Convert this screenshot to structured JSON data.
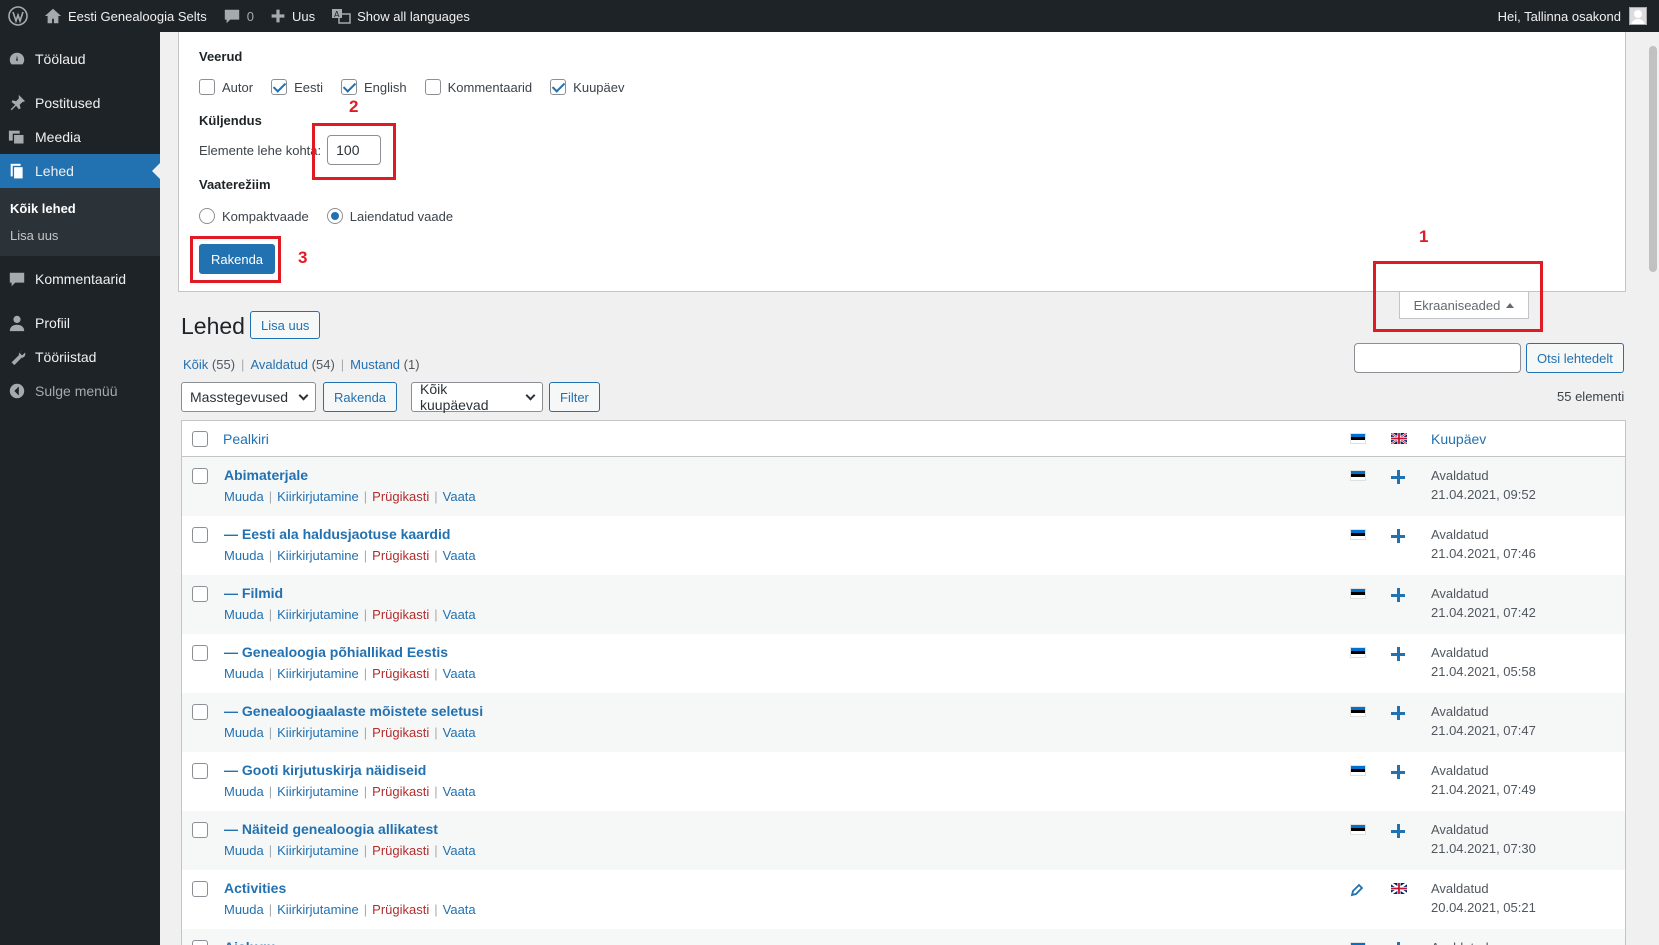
{
  "adminbar": {
    "site_name": "Eesti Genealoogia Selts",
    "comments_count": "0",
    "new_label": "Uus",
    "languages_label": "Show all languages",
    "greeting": "Hei, Tallinna osakond"
  },
  "sidebar": {
    "items": [
      {
        "label": "Töölaud",
        "icon": "dashboard-icon"
      },
      {
        "label": "Postitused",
        "icon": "pin-icon"
      },
      {
        "label": "Meedia",
        "icon": "media-icon"
      },
      {
        "label": "Lehed",
        "icon": "pages-icon"
      },
      {
        "label": "Kommentaarid",
        "icon": "comments-icon"
      },
      {
        "label": "Profiil",
        "icon": "user-icon"
      },
      {
        "label": "Tööriistad",
        "icon": "wrench-icon"
      },
      {
        "label": "Sulge menüü",
        "icon": "collapse-icon"
      }
    ],
    "submenu": [
      "Kõik lehed",
      "Lisa uus"
    ]
  },
  "screen_options": {
    "columns_legend": "Veerud",
    "columns": [
      {
        "label": "Autor",
        "checked": false
      },
      {
        "label": "Eesti",
        "checked": true
      },
      {
        "label": "English",
        "checked": true
      },
      {
        "label": "Kommentaarid",
        "checked": false
      },
      {
        "label": "Kuupäev",
        "checked": true
      }
    ],
    "pagination_legend": "Küljendus",
    "per_page_label": "Elemente lehe kohta:",
    "per_page_value": "100",
    "view_mode_legend": "Vaaterežiim",
    "view_modes": [
      {
        "label": "Kompaktvaade",
        "checked": false
      },
      {
        "label": "Laiendatud vaade",
        "checked": true
      }
    ],
    "apply_label": "Rakenda",
    "tab_label": "Ekraaniseaded"
  },
  "annotations": [
    "1",
    "2",
    "3"
  ],
  "page": {
    "title": "Lehed",
    "add_new": "Lisa uus",
    "views": [
      {
        "label": "Kõik",
        "count": "(55)"
      },
      {
        "label": "Avaldatud",
        "count": "(54)"
      },
      {
        "label": "Mustand",
        "count": "(1)"
      }
    ],
    "search_button": "Otsi lehtedelt",
    "bulk_actions": "Masstegevused",
    "bulk_apply": "Rakenda",
    "dates": "Kõik kuupäevad",
    "filter": "Filter",
    "items_count": "55 elementi"
  },
  "table": {
    "col_title": "Pealkiri",
    "col_date": "Kuupäev",
    "row_actions": [
      "Muuda",
      "Kiirkirjutamine",
      "Prügikasti",
      "Vaata"
    ],
    "rows": [
      {
        "title": "Abimaterjale",
        "status": "Avaldatud",
        "date": "21.04.2021, 09:52",
        "et": "flag",
        "en": "add"
      },
      {
        "title": "— Eesti ala haldusjaotuse kaardid",
        "status": "Avaldatud",
        "date": "21.04.2021, 07:46",
        "et": "flag",
        "en": "add"
      },
      {
        "title": "— Filmid",
        "status": "Avaldatud",
        "date": "21.04.2021, 07:42",
        "et": "flag",
        "en": "add"
      },
      {
        "title": "— Genealoogia põhiallikad Eestis",
        "status": "Avaldatud",
        "date": "21.04.2021, 05:58",
        "et": "flag",
        "en": "add"
      },
      {
        "title": "— Genealoogiaalaste mõistete seletusi",
        "status": "Avaldatud",
        "date": "21.04.2021, 07:47",
        "et": "flag",
        "en": "add"
      },
      {
        "title": "— Gooti kirjutuskirja näidiseid",
        "status": "Avaldatud",
        "date": "21.04.2021, 07:49",
        "et": "flag",
        "en": "add"
      },
      {
        "title": "— Näiteid genealoogia allikatest",
        "status": "Avaldatud",
        "date": "21.04.2021, 07:30",
        "et": "flag",
        "en": "add"
      },
      {
        "title": "Activities",
        "status": "Avaldatud",
        "date": "20.04.2021, 05:21",
        "et": "edit",
        "en": "flag"
      },
      {
        "title": "Ajalugu",
        "status": "Avaldatud",
        "date": "",
        "et": "flag",
        "en": "add"
      }
    ]
  },
  "colors": {
    "accent": "#2271b1",
    "admin_dark": "#1d2327",
    "annotation_red": "#e01b24",
    "trash_red": "#b32d2e"
  }
}
